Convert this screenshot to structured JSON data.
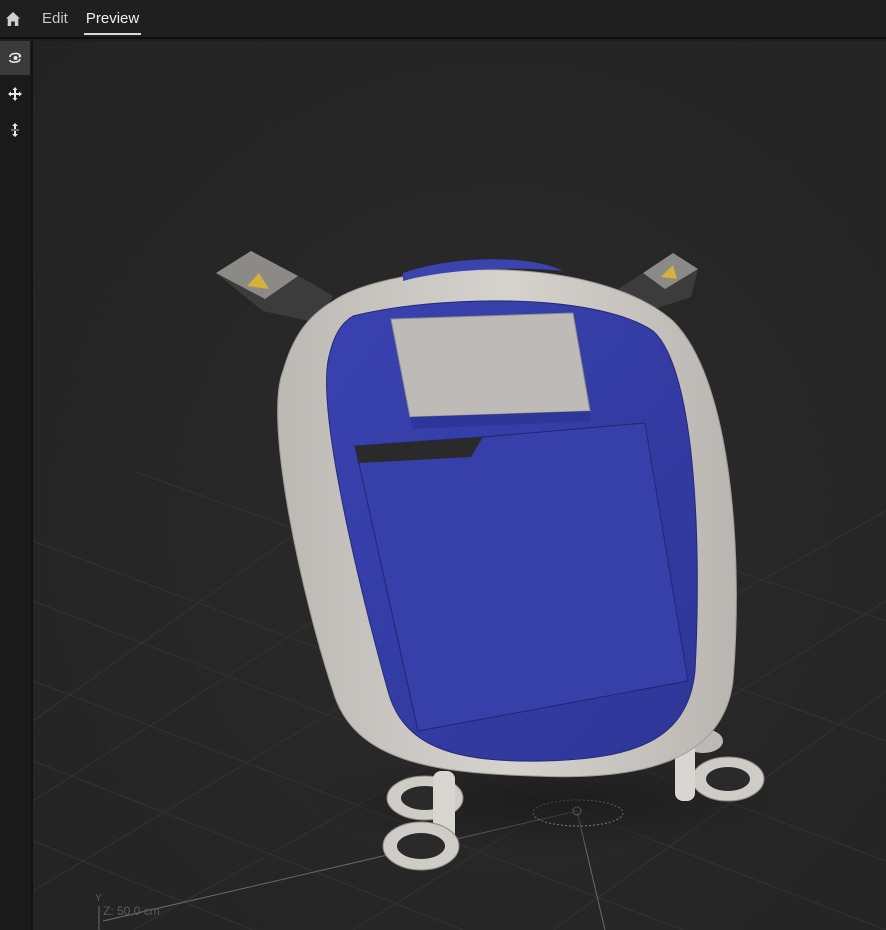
{
  "topbar": {
    "home_icon": "home-icon",
    "tabs": [
      {
        "label": "Edit",
        "active": false
      },
      {
        "label": "Preview",
        "active": true
      }
    ]
  },
  "toolbar": {
    "tools": [
      {
        "name": "orbit-icon",
        "active": true
      },
      {
        "name": "move-icon",
        "active": false
      },
      {
        "name": "dolly-icon",
        "active": false
      }
    ]
  },
  "viewport": {
    "axis_y_label": "Y",
    "axis_z_readout": "Z: 50,0 cm"
  },
  "colors": {
    "accent_blue": "#3a43ae",
    "shell": "#cfcbc6",
    "background": "#262626"
  }
}
